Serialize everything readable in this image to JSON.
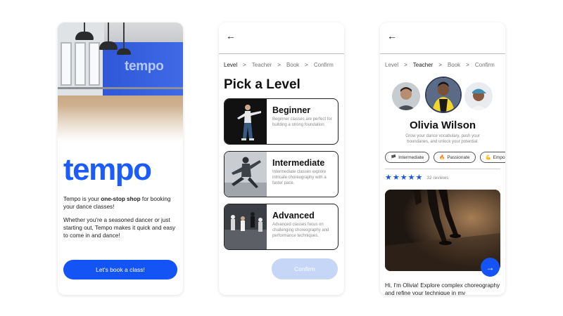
{
  "welcome": {
    "wall_logo": "tempo",
    "logo": "tempo",
    "intro_before": "Tempo is your ",
    "intro_bold": "one-stop shop",
    "intro_after": " for booking your dance classes!",
    "intro_2": "Whether you're a seasoned dancer or just starting out, Tempo makes it quick and easy to come in and dance!",
    "cta_label": "Let's book a class!"
  },
  "steps": [
    "Level",
    "Teacher",
    "Book",
    "Confirm"
  ],
  "level_screen": {
    "back_icon": "←",
    "active_step": 0,
    "title": "Pick a Level",
    "levels": [
      {
        "name": "Beginner",
        "description": "Beginner classes are perfect for building a strong foundation"
      },
      {
        "name": "Intermediate",
        "description": "Intermediate classes explore intricate choreography with a faster pace."
      },
      {
        "name": "Advanced",
        "description": "Advanced classes focus on challenging choreography and performance techniques."
      }
    ],
    "confirm_label": "Confirm"
  },
  "teacher_screen": {
    "back_icon": "←",
    "active_step": 1,
    "name": "Olivia Wilson",
    "bio": "Grow your dance vocabulary, push your boundaries, and unlock your potential.",
    "chips": [
      {
        "icon": "🏴",
        "label": "Intermediate"
      },
      {
        "icon": "🔥",
        "label": "Passionate"
      },
      {
        "icon": "💪",
        "label": "Empo"
      }
    ],
    "rating": 5,
    "reviews": "32 reviews",
    "next_icon": "→",
    "intro": "Hi, I'm Olivia! Explore complex choreography and refine your technique in my"
  },
  "colors": {
    "brand_blue": "#1454f5",
    "logo_blue": "#1c5cff",
    "confirm_disabled": "#c6d6f7",
    "star": "#1a55e0"
  }
}
